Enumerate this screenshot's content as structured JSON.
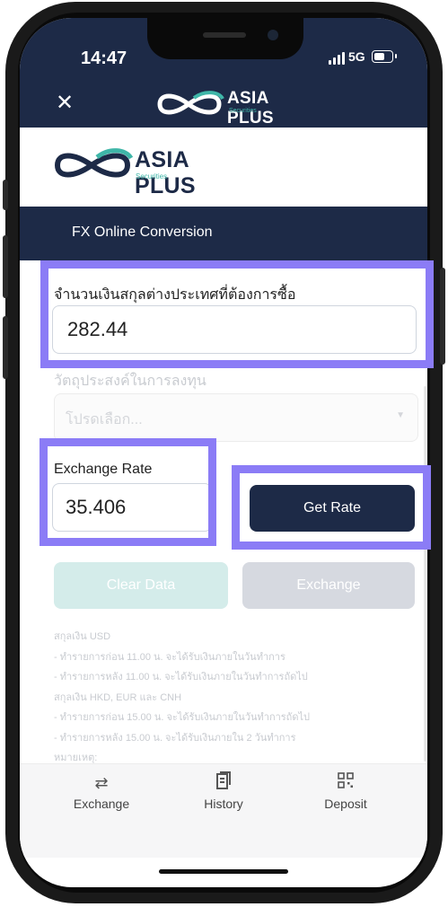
{
  "status_bar": {
    "time": "14:47",
    "network": "5G"
  },
  "header": {
    "brand": "ASIA PLUS",
    "sub": "Securities",
    "close_icon": "close-icon"
  },
  "logo": {
    "brand": "ASIA PLUS",
    "sub": "Securities"
  },
  "banner": {
    "title": "FX Online Conversion"
  },
  "form": {
    "amount_label": "จำนวนเงินสกุลต่างประเทศที่ต้องการซื้อ",
    "amount_value": "282.44",
    "purpose_label": "วัตถุประสงค์ในการลงทุน",
    "purpose_placeholder": "โปรดเลือก...",
    "rate_label": "Exchange Rate",
    "rate_value": "35.406",
    "get_rate_button": "Get Rate",
    "clear_button": "Clear Data",
    "exchange_button": "Exchange"
  },
  "notes": [
    "สกุลเงิน USD",
    "- ทำรายการก่อน 11.00 น. จะได้รับเงินภายในวันทำการ",
    "- ทำรายการหลัง 11.00 น. จะได้รับเงินภายในวันทำการถัดไป",
    "สกุลเงิน HKD, EUR และ CNH",
    "- ทำรายการก่อน 15.00 น. จะได้รับเงินภายในวันทำการถัดไป",
    "- ทำรายการหลัง 15.00 น. จะได้รับเงินภายใน 2 วันทำการ",
    "หมายเหตุ:"
  ],
  "tabs": [
    {
      "label": "Exchange",
      "icon": "exchange-arrows-icon"
    },
    {
      "label": "History",
      "icon": "history-document-icon"
    },
    {
      "label": "Deposit",
      "icon": "qr-code-icon"
    }
  ],
  "colors": {
    "navy": "#1d2a47",
    "teal": "#3fb6a8",
    "highlight": "#8b7cf6"
  }
}
